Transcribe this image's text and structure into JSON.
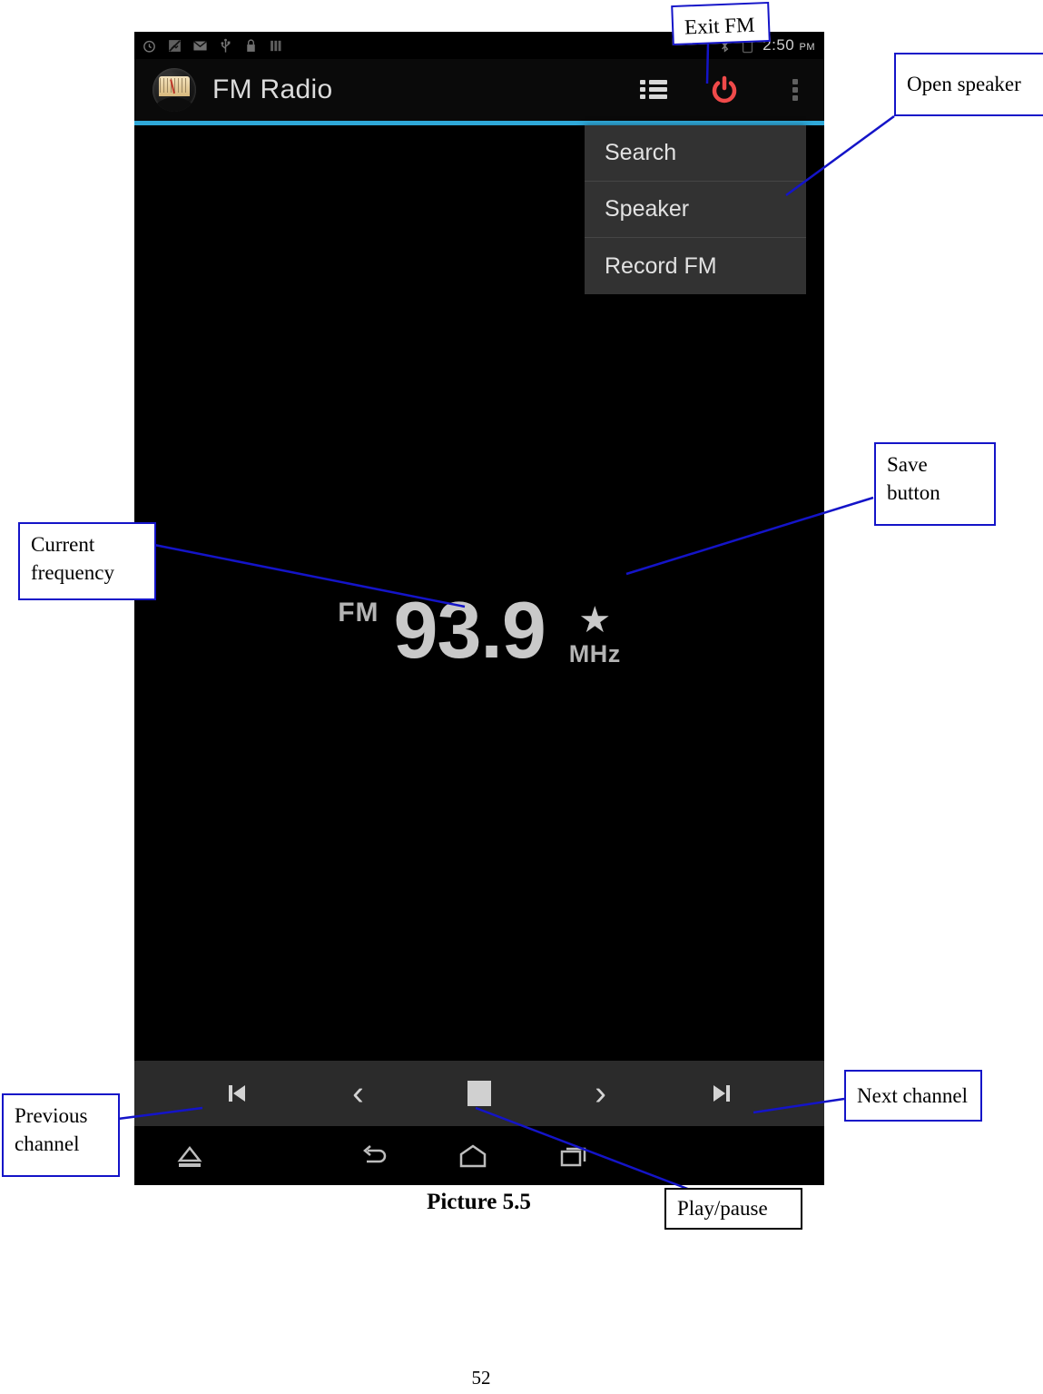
{
  "document": {
    "caption": "Picture 5.5",
    "page_number": "52"
  },
  "phone": {
    "status_bar": {
      "time": "2:50",
      "ampm": "PM",
      "icons": [
        "alarm-clock-icon",
        "no-sim-icon",
        "email-icon",
        "usb-icon",
        "lock-icon",
        "signal-bars-icon"
      ],
      "right_icons": [
        "bluetooth-icon",
        "battery-icon"
      ]
    },
    "action_bar": {
      "app_title": "FM Radio",
      "logo_name": "fm-radio-dial-logo",
      "actions": [
        {
          "name": "channel-list-button",
          "label": "Channel list"
        },
        {
          "name": "power-exit-button",
          "label": "Exit FM"
        },
        {
          "name": "overflow-menu-button",
          "label": "More options"
        }
      ],
      "accent_color": "#2fa8d8",
      "power_color": "#f04040"
    },
    "overflow_menu": {
      "items": [
        {
          "label": "Search"
        },
        {
          "label": "Speaker"
        },
        {
          "label": "Record FM"
        }
      ]
    },
    "tuner": {
      "band_label": "FM",
      "frequency": "93.9",
      "unit": "MHz",
      "save_star": "★"
    },
    "controls": [
      {
        "name": "previous-channel-button",
        "glyph": "◀",
        "label": "Previous channel"
      },
      {
        "name": "seek-down-button",
        "glyph": "‹",
        "label": "Seek down"
      },
      {
        "name": "play-pause-button",
        "glyph": "",
        "label": "Play/pause"
      },
      {
        "name": "seek-up-button",
        "glyph": "›",
        "label": "Seek up"
      },
      {
        "name": "next-channel-button",
        "glyph": "▶",
        "label": "Next channel"
      }
    ],
    "nav_bar": [
      {
        "name": "nav-eject-button",
        "label": "Eject"
      },
      {
        "name": "nav-back-button",
        "label": "Back"
      },
      {
        "name": "nav-home-button",
        "label": "Home"
      },
      {
        "name": "nav-recents-button",
        "label": "Recent apps"
      }
    ]
  },
  "annotations": {
    "exit_fm": "Exit FM",
    "open_speaker": "Open speaker",
    "save_button": "Save\nbutton",
    "save_button_line1": "Save",
    "save_button_line2": "button",
    "current_frequency_line1": "Current",
    "current_frequency_line2": "frequency",
    "previous_channel_line1": "Previous",
    "previous_channel_line2": "channel",
    "next_channel": "Next channel",
    "play_pause": "Play/pause",
    "line_color": "#1414c8"
  }
}
